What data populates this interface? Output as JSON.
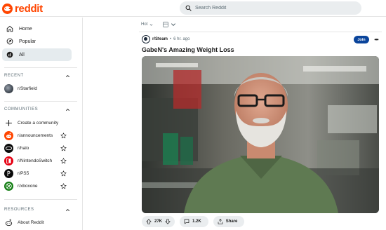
{
  "header": {
    "logo_text": "reddit",
    "search_placeholder": "Search Reddit"
  },
  "sidebar": {
    "nav": [
      {
        "label": "Home",
        "icon": "home-icon"
      },
      {
        "label": "Popular",
        "icon": "popular-icon"
      },
      {
        "label": "All",
        "icon": "all-icon",
        "active": true
      }
    ],
    "recent": {
      "heading": "RECENT",
      "items": [
        {
          "label": "r/Starfield"
        }
      ]
    },
    "communities": {
      "heading": "COMMUNITIES",
      "create_label": "Create a community",
      "items": [
        {
          "label": "r/announcements"
        },
        {
          "label": "r/halo"
        },
        {
          "label": "r/NintendoSwitch"
        },
        {
          "label": "r/PS5"
        },
        {
          "label": "r/xboxone"
        }
      ]
    },
    "resources": {
      "heading": "RESOURCES",
      "items": [
        {
          "label": "About Reddit"
        }
      ]
    }
  },
  "feed": {
    "sort_label": "Hot"
  },
  "post": {
    "subreddit": "r/Steam",
    "separator": "•",
    "time": "6 hr. ago",
    "join_label": "Join",
    "more_label": "•••",
    "title": "GabeN's Amazing Weight Loss",
    "upvotes": "27K",
    "comments": "1.2K",
    "share_label": "Share"
  },
  "colors": {
    "brand": "#ff4500",
    "join_button": "#0a449b",
    "active_nav": "#e5ebee",
    "pill_bg": "#eaedef"
  }
}
